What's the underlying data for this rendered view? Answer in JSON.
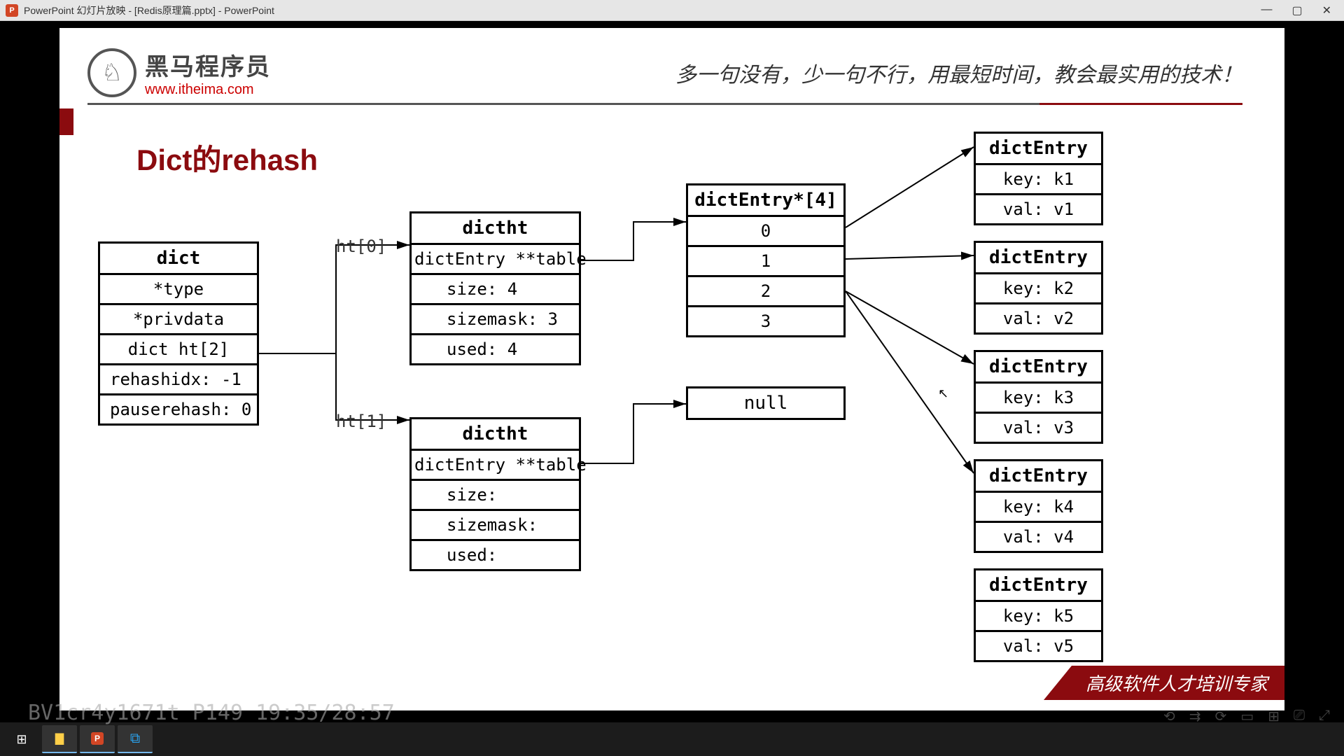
{
  "window": {
    "title": "PowerPoint 幻灯片放映 - [Redis原理篇.pptx] - PowerPoint",
    "icon_letter": "P"
  },
  "brand": {
    "name": "黑马程序员",
    "url": "www.itheima.com",
    "logo_glyph": "♘"
  },
  "tagline": "多一句没有，少一句不行，用最短时间，教会最实用的技术！",
  "slide_title": "Dict的rehash",
  "dict_box": {
    "title": "dict",
    "rows": [
      "*type",
      "*privdata",
      "dict ht[2]",
      "rehashidx: -1",
      "pauserehash: 0"
    ]
  },
  "ht_labels": {
    "a": "ht[0]",
    "b": "ht[1]"
  },
  "dictht0": {
    "title": "dictht",
    "rows": [
      "dictEntry **table",
      "size: 4",
      "sizemask: 3",
      "used: 4"
    ]
  },
  "dictht1": {
    "title": "dictht",
    "rows": [
      "dictEntry **table",
      "size: ",
      "sizemask: ",
      "used: "
    ]
  },
  "array_box": {
    "title": "dictEntry*[4]",
    "slots": [
      "0",
      "1",
      "2",
      "3"
    ]
  },
  "null_box": {
    "label": "null"
  },
  "entries": [
    {
      "title": "dictEntry",
      "key": "key: k1",
      "val": "val: v1"
    },
    {
      "title": "dictEntry",
      "key": "key: k2",
      "val": "val: v2"
    },
    {
      "title": "dictEntry",
      "key": "key: k3",
      "val": "val: v3"
    },
    {
      "title": "dictEntry",
      "key": "key: k4",
      "val": "val: v4"
    },
    {
      "title": "dictEntry",
      "key": "key: k5",
      "val": "val: v5"
    }
  ],
  "ribbon": "高级软件人才培训专家",
  "video_overlay": "BV1cr4y1671t P149 19:35/28:57"
}
